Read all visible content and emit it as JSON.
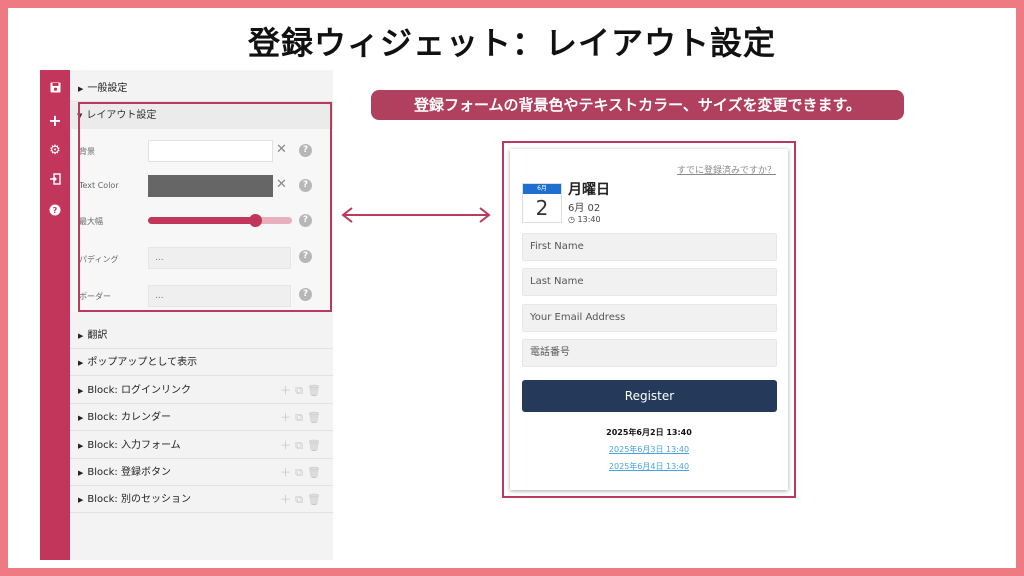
{
  "title": "登録ウィジェット：レイアウト設定",
  "annotation": "登録フォームの背景色やテキストカラー、サイズを変更できます。",
  "colors": {
    "accent": "#c1365a",
    "frame": "#b83a5c",
    "register_button": "#25395a",
    "calendar_header": "#1f6fd1",
    "text_color_swatch": "#666666"
  },
  "icon_bar": {
    "icons": [
      "save-icon",
      "plus-icon",
      "gear-icon",
      "sign-in-icon",
      "help-icon"
    ]
  },
  "panel": {
    "general": "一般設定",
    "layout": {
      "header": "レイアウト設定",
      "background_label": "背景",
      "text_color_label": "Text Color",
      "max_width_label": "最大幅",
      "max_width_percent": 74,
      "padding_label": "パディング",
      "padding_value": "...",
      "border_label": "ボーダー",
      "border_value": "..."
    },
    "translation": "翻訳",
    "popup": "ポップアップとして表示",
    "blocks": [
      "Block:  ログインリンク",
      "Block:  カレンダー",
      "Block:  入力フォーム",
      "Block:  登録ボタン",
      "Block:  別のセッション"
    ]
  },
  "preview": {
    "already_registered": "すでに登録済みですか？",
    "calendar_month": "6月",
    "calendar_day": "2",
    "day_of_week": "月曜日",
    "date": "6月 02",
    "time": "13:40",
    "fields": [
      "First Name",
      "Last Name",
      "Your Email Address",
      "電話番号"
    ],
    "register": "Register",
    "session_current": "2025年6月2日 13:40",
    "session_links": [
      "2025年6月3日 13:40",
      "2025年6月4日 13:40"
    ]
  }
}
